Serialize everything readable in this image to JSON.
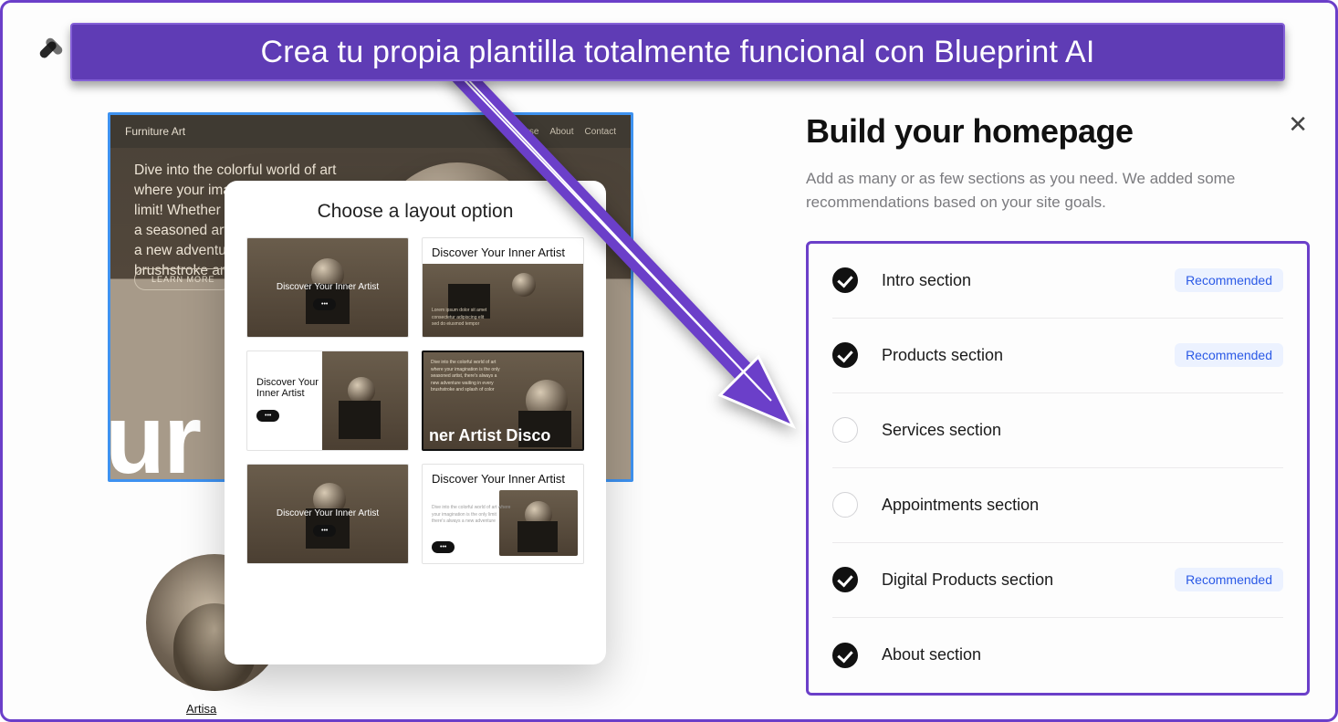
{
  "banner": {
    "text": "Crea tu propia plantilla totalmente funcional con Blueprint AI"
  },
  "preview": {
    "brand": "Furniture Art",
    "nav": [
      "Course",
      "About",
      "Contact"
    ],
    "hero_text": "Dive into the colorful world of art where your imagination is the only limit! Whether you're a doodler or a seasoned artist, there's always a new adventure waiting in every brushstroke and splash of color.",
    "learn_more": "LEARN MORE",
    "big_text": "ur",
    "circle_caption": "Artisa"
  },
  "layout_modal": {
    "title": "Choose a layout option",
    "thumbs": {
      "t1": "Discover Your Inner Artist",
      "t2": "Discover Your Inner Artist",
      "t3": "Discover Your Inner Artist",
      "t4": "ner Artist Disco",
      "t5": "Discover Your Inner Artist",
      "t6": "Discover Your Inner Artist"
    }
  },
  "right": {
    "title": "Build your homepage",
    "subtitle": "Add as many or as few sections as you need. We added some recommendations based on your site goals.",
    "close": "✕",
    "badge": "Recommended",
    "sections": {
      "s1": "Intro section",
      "s2": "Products section",
      "s3": "Services section",
      "s4": "Appointments section",
      "s5": "Digital Products section",
      "s6": "About section"
    }
  }
}
